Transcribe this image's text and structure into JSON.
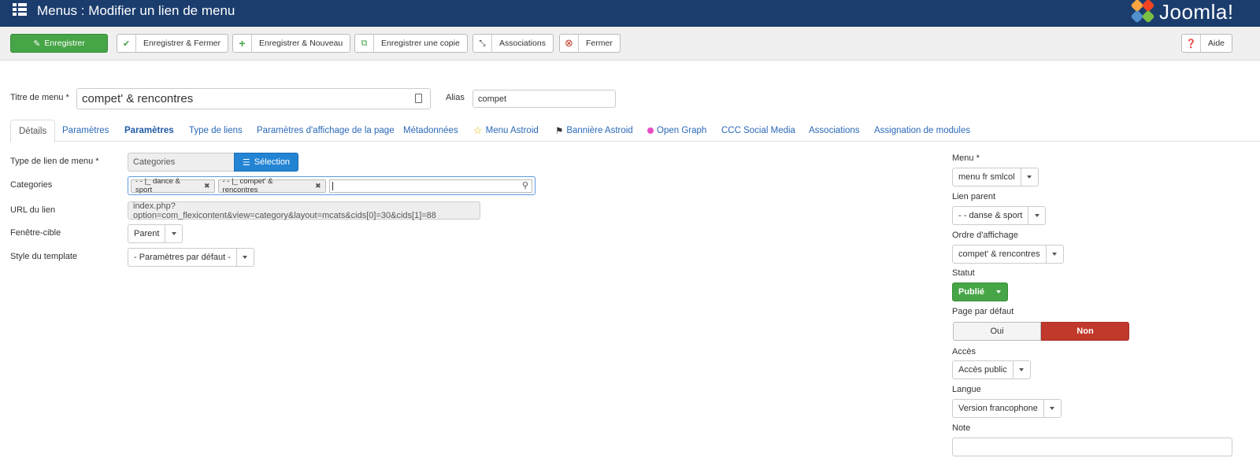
{
  "header": {
    "title": "Menus : Modifier un lien de menu",
    "brand": "Joomla!"
  },
  "toolbar": {
    "save": "Enregistrer",
    "save_close": "Enregistrer & Fermer",
    "save_new": "Enregistrer & Nouveau",
    "save_copy": "Enregistrer une copie",
    "associations": "Associations",
    "close": "Fermer",
    "help": "Aide"
  },
  "title_row": {
    "title_label": "Titre de menu *",
    "title_value": "compet' & rencontres",
    "alias_label": "Alias",
    "alias_value": "compet"
  },
  "tabs": [
    "Détails",
    "Paramètres",
    "Paramètres",
    "Type de liens",
    "Paramètres d'affichage de la page",
    "Métadonnées",
    "Menu Astroid",
    "Bannière Astroid",
    "Open Graph",
    "CCC Social Media",
    "Associations",
    "Assignation de modules"
  ],
  "form": {
    "link_type_label": "Type de lien de menu *",
    "link_type_value": "Categories",
    "selection_button": "Sélection",
    "categories_label": "Categories",
    "categories_chips": [
      "- - |_ dance & sport",
      "- - |_ compet' & rencontres"
    ],
    "url_label": "URL du lien",
    "url_value": "index.php?option=com_flexicontent&view=category&layout=mcats&cids[0]=30&cids[1]=88",
    "target_label": "Fenêtre-cible",
    "target_value": "Parent",
    "template_label": "Style du template",
    "template_value": "- Paramètres par défaut -"
  },
  "sidebar": {
    "menu_label": "Menu *",
    "menu_value": "menu fr smlcol",
    "parent_label": "Lien parent",
    "parent_value": "- - danse & sport",
    "order_label": "Ordre d'affichage",
    "order_value": "compet' & rencontres",
    "status_label": "Statut",
    "status_value": "Publié",
    "default_label": "Page par défaut",
    "default_yes": "Oui",
    "default_no": "Non",
    "access_label": "Accès",
    "access_value": "Accès public",
    "language_label": "Langue",
    "language_value": "Version francophone",
    "note_label": "Note",
    "note_value": ""
  },
  "colors": {
    "header_bg": "#1b3d6e",
    "save_green": "#46a546",
    "selection_blue": "#2384d3",
    "status_green": "#46a546",
    "no_red": "#c0392b",
    "link_blue": "#2a69b8"
  }
}
